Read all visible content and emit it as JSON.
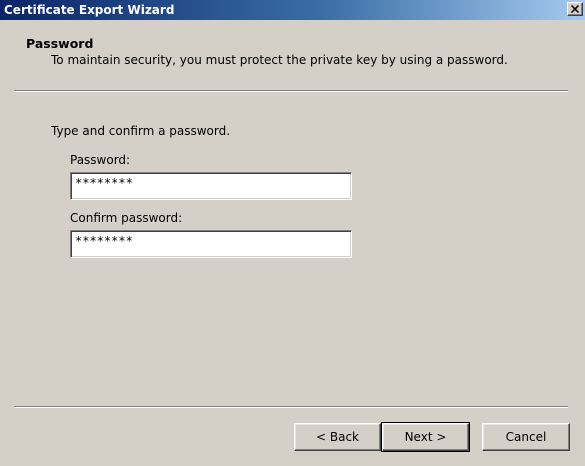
{
  "window": {
    "title": "Certificate Export Wizard"
  },
  "header": {
    "title": "Password",
    "description": "To maintain security, you must protect the private key by using a password."
  },
  "form": {
    "instruction": "Type and confirm a password.",
    "password_label": "Password:",
    "password_value": "********",
    "confirm_label": "Confirm password:",
    "confirm_value": "********"
  },
  "buttons": {
    "back": "< Back",
    "next": "Next >",
    "cancel": "Cancel"
  },
  "icons": {
    "close": "close-icon"
  }
}
